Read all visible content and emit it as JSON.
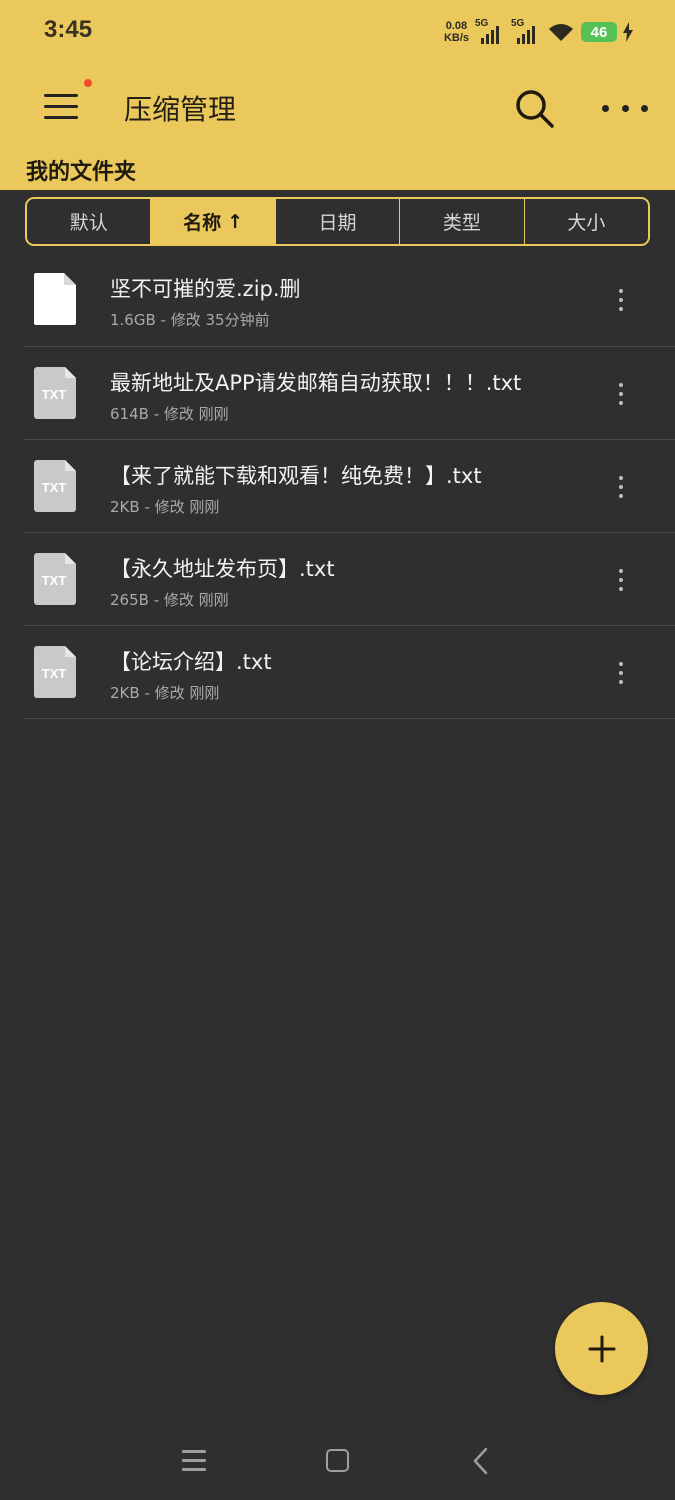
{
  "status_bar": {
    "time": "3:45",
    "net_speed_value": "0.08",
    "net_speed_unit": "KB/s",
    "signal_1_label": "5G",
    "signal_2_label": "5G",
    "battery": "46",
    "icons": [
      "wifi-icon",
      "charging-icon"
    ]
  },
  "app_bar": {
    "title": "压缩管理",
    "folder_label": "我的文件夹",
    "icons": [
      "menu-icon",
      "search-icon",
      "more-icon"
    ]
  },
  "sort_tabs": [
    {
      "label": "默认",
      "active": false
    },
    {
      "label": "名称",
      "active": true,
      "arrow": "↑"
    },
    {
      "label": "日期",
      "active": false
    },
    {
      "label": "类型",
      "active": false
    },
    {
      "label": "大小",
      "active": false
    }
  ],
  "files": [
    {
      "name": "坚不可摧的爱.zip.删",
      "meta": "1.6GB - 修改 35分钟前",
      "icon": "blank-file-icon"
    },
    {
      "name": "最新地址及APP请发邮箱自动获取！！！.txt",
      "meta": "614B - 修改 刚刚",
      "icon": "txt-file-icon",
      "icon_text": "TXT"
    },
    {
      "name": "【来了就能下载和观看！纯免费！】.txt",
      "meta": "2KB - 修改 刚刚",
      "icon": "txt-file-icon",
      "icon_text": "TXT"
    },
    {
      "name": "【永久地址发布页】.txt",
      "meta": "265B - 修改 刚刚",
      "icon": "txt-file-icon",
      "icon_text": "TXT"
    },
    {
      "name": "【论坛介绍】.txt",
      "meta": "2KB - 修改 刚刚",
      "icon": "txt-file-icon",
      "icon_text": "TXT"
    }
  ],
  "fab_icon": "plus-icon",
  "colors": {
    "accent": "#ebc85b",
    "background": "#2f2f30",
    "notification_dot": "#f04a2a",
    "battery": "#55c157"
  }
}
